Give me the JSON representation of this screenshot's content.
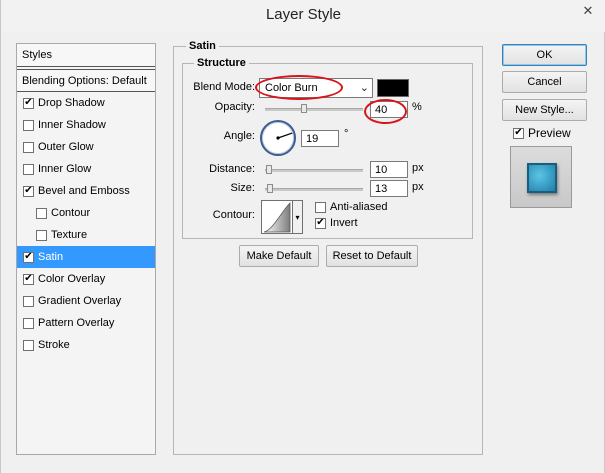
{
  "window": {
    "title": "Layer Style",
    "close_glyph": "✕"
  },
  "styles_list": {
    "header": "Styles",
    "blending_options": "Blending Options: Default",
    "items": [
      {
        "label": "Drop Shadow",
        "checked": true,
        "sub": false,
        "selected": false
      },
      {
        "label": "Inner Shadow",
        "checked": false,
        "sub": false,
        "selected": false
      },
      {
        "label": "Outer Glow",
        "checked": false,
        "sub": false,
        "selected": false
      },
      {
        "label": "Inner Glow",
        "checked": false,
        "sub": false,
        "selected": false
      },
      {
        "label": "Bevel and Emboss",
        "checked": true,
        "sub": false,
        "selected": false
      },
      {
        "label": "Contour",
        "checked": false,
        "sub": true,
        "selected": false
      },
      {
        "label": "Texture",
        "checked": false,
        "sub": true,
        "selected": false
      },
      {
        "label": "Satin",
        "checked": true,
        "sub": false,
        "selected": true
      },
      {
        "label": "Color Overlay",
        "checked": true,
        "sub": false,
        "selected": false
      },
      {
        "label": "Gradient Overlay",
        "checked": false,
        "sub": false,
        "selected": false
      },
      {
        "label": "Pattern Overlay",
        "checked": false,
        "sub": false,
        "selected": false
      },
      {
        "label": "Stroke",
        "checked": false,
        "sub": false,
        "selected": false
      }
    ]
  },
  "satin": {
    "group_title": "Satin",
    "structure_title": "Structure",
    "blend_mode": {
      "label": "Blend Mode:",
      "value": "Color Burn",
      "color": "#000000"
    },
    "opacity": {
      "label": "Opacity:",
      "value": "40",
      "unit": "%",
      "fraction": 0.4
    },
    "angle": {
      "label": "Angle:",
      "value": "19",
      "unit": "°"
    },
    "distance": {
      "label": "Distance:",
      "value": "10",
      "unit": "px",
      "fraction": 0.04
    },
    "size": {
      "label": "Size:",
      "value": "13",
      "unit": "px",
      "fraction": 0.05
    },
    "contour": {
      "label": "Contour:"
    },
    "anti_aliased": {
      "label": "Anti-aliased",
      "checked": false
    },
    "invert": {
      "label": "Invert",
      "checked": true
    },
    "make_default": "Make Default",
    "reset_default": "Reset to Default"
  },
  "actions": {
    "ok": "OK",
    "cancel": "Cancel",
    "new_style": "New Style...",
    "preview_label": "Preview",
    "preview_checked": true
  },
  "colors": {
    "selection": "#3399ff",
    "annotation_red": "#d7141a",
    "preview_fill": "#2a9fcb"
  }
}
